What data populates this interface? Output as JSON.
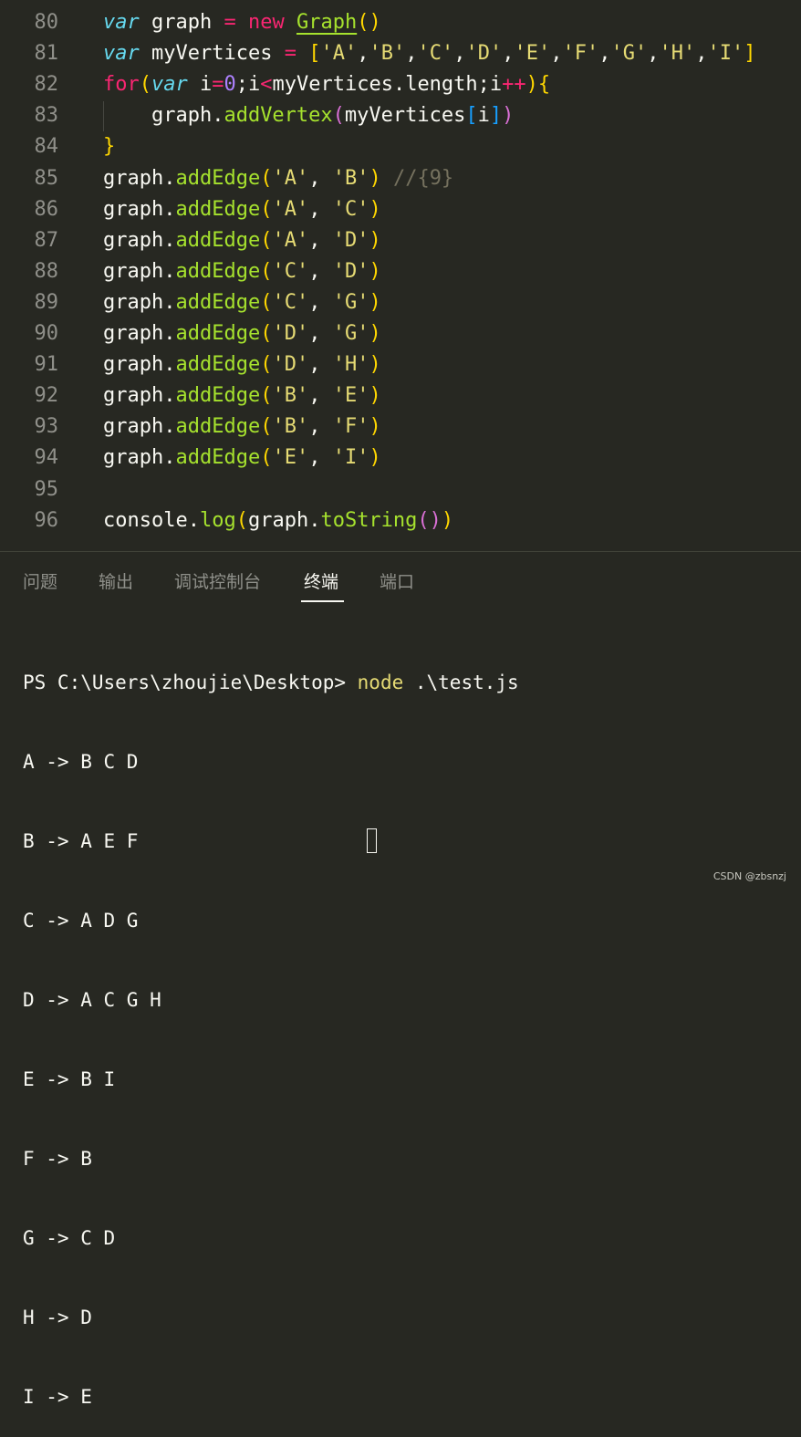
{
  "editor": {
    "lines": [
      {
        "n": "80",
        "tokens": [
          [
            "kw",
            "var"
          ],
          [
            "white",
            " graph "
          ],
          [
            "pink",
            "="
          ],
          [
            "white",
            " "
          ],
          [
            "pink",
            "new"
          ],
          [
            "white",
            " "
          ],
          [
            "cls",
            "Graph"
          ],
          [
            "b1",
            "()"
          ]
        ]
      },
      {
        "n": "81",
        "tokens": [
          [
            "kw",
            "var"
          ],
          [
            "white",
            " myVertices "
          ],
          [
            "pink",
            "="
          ],
          [
            "white",
            " "
          ],
          [
            "b1",
            "["
          ],
          [
            "str",
            "'A'"
          ],
          [
            "white",
            ","
          ],
          [
            "str",
            "'B'"
          ],
          [
            "white",
            ","
          ],
          [
            "str",
            "'C'"
          ],
          [
            "white",
            ","
          ],
          [
            "str",
            "'D'"
          ],
          [
            "white",
            ","
          ],
          [
            "str",
            "'E'"
          ],
          [
            "white",
            ","
          ],
          [
            "str",
            "'F'"
          ],
          [
            "white",
            ","
          ],
          [
            "str",
            "'G'"
          ],
          [
            "white",
            ","
          ],
          [
            "str",
            "'H'"
          ],
          [
            "white",
            ","
          ],
          [
            "str",
            "'I'"
          ],
          [
            "b1",
            "]"
          ]
        ]
      },
      {
        "n": "82",
        "tokens": [
          [
            "pink",
            "for"
          ],
          [
            "b1",
            "("
          ],
          [
            "kw",
            "var"
          ],
          [
            "white",
            " i"
          ],
          [
            "pink",
            "="
          ],
          [
            "num",
            "0"
          ],
          [
            "white",
            ";i"
          ],
          [
            "pink",
            "<"
          ],
          [
            "white",
            "myVertices.length;i"
          ],
          [
            "pink",
            "++"
          ],
          [
            "b1",
            ")"
          ],
          [
            "b1",
            "{"
          ]
        ]
      },
      {
        "n": "83",
        "tokens": [
          [
            "white",
            "    graph."
          ],
          [
            "fn",
            "addVertex"
          ],
          [
            "b2",
            "("
          ],
          [
            "white",
            "myVertices"
          ],
          [
            "b3",
            "["
          ],
          [
            "white",
            "i"
          ],
          [
            "b3",
            "]"
          ],
          [
            "b2",
            ")"
          ]
        ]
      },
      {
        "n": "84",
        "tokens": [
          [
            "b1",
            "}"
          ]
        ]
      },
      {
        "n": "85",
        "tokens": [
          [
            "white",
            "graph."
          ],
          [
            "fn",
            "addEdge"
          ],
          [
            "b1",
            "("
          ],
          [
            "str",
            "'A'"
          ],
          [
            "white",
            ", "
          ],
          [
            "str",
            "'B'"
          ],
          [
            "b1",
            ")"
          ],
          [
            "white",
            " "
          ],
          [
            "cmt",
            "//{9}"
          ]
        ]
      },
      {
        "n": "86",
        "tokens": [
          [
            "white",
            "graph."
          ],
          [
            "fn",
            "addEdge"
          ],
          [
            "b1",
            "("
          ],
          [
            "str",
            "'A'"
          ],
          [
            "white",
            ", "
          ],
          [
            "str",
            "'C'"
          ],
          [
            "b1",
            ")"
          ]
        ]
      },
      {
        "n": "87",
        "tokens": [
          [
            "white",
            "graph."
          ],
          [
            "fn",
            "addEdge"
          ],
          [
            "b1",
            "("
          ],
          [
            "str",
            "'A'"
          ],
          [
            "white",
            ", "
          ],
          [
            "str",
            "'D'"
          ],
          [
            "b1",
            ")"
          ]
        ]
      },
      {
        "n": "88",
        "tokens": [
          [
            "white",
            "graph."
          ],
          [
            "fn",
            "addEdge"
          ],
          [
            "b1",
            "("
          ],
          [
            "str",
            "'C'"
          ],
          [
            "white",
            ", "
          ],
          [
            "str",
            "'D'"
          ],
          [
            "b1",
            ")"
          ]
        ]
      },
      {
        "n": "89",
        "tokens": [
          [
            "white",
            "graph."
          ],
          [
            "fn",
            "addEdge"
          ],
          [
            "b1",
            "("
          ],
          [
            "str",
            "'C'"
          ],
          [
            "white",
            ", "
          ],
          [
            "str",
            "'G'"
          ],
          [
            "b1",
            ")"
          ]
        ]
      },
      {
        "n": "90",
        "tokens": [
          [
            "white",
            "graph."
          ],
          [
            "fn",
            "addEdge"
          ],
          [
            "b1",
            "("
          ],
          [
            "str",
            "'D'"
          ],
          [
            "white",
            ", "
          ],
          [
            "str",
            "'G'"
          ],
          [
            "b1",
            ")"
          ]
        ]
      },
      {
        "n": "91",
        "tokens": [
          [
            "white",
            "graph."
          ],
          [
            "fn",
            "addEdge"
          ],
          [
            "b1",
            "("
          ],
          [
            "str",
            "'D'"
          ],
          [
            "white",
            ", "
          ],
          [
            "str",
            "'H'"
          ],
          [
            "b1",
            ")"
          ]
        ]
      },
      {
        "n": "92",
        "tokens": [
          [
            "white",
            "graph."
          ],
          [
            "fn",
            "addEdge"
          ],
          [
            "b1",
            "("
          ],
          [
            "str",
            "'B'"
          ],
          [
            "white",
            ", "
          ],
          [
            "str",
            "'E'"
          ],
          [
            "b1",
            ")"
          ]
        ]
      },
      {
        "n": "93",
        "tokens": [
          [
            "white",
            "graph."
          ],
          [
            "fn",
            "addEdge"
          ],
          [
            "b1",
            "("
          ],
          [
            "str",
            "'B'"
          ],
          [
            "white",
            ", "
          ],
          [
            "str",
            "'F'"
          ],
          [
            "b1",
            ")"
          ]
        ]
      },
      {
        "n": "94",
        "tokens": [
          [
            "white",
            "graph."
          ],
          [
            "fn",
            "addEdge"
          ],
          [
            "b1",
            "("
          ],
          [
            "str",
            "'E'"
          ],
          [
            "white",
            ", "
          ],
          [
            "str",
            "'I'"
          ],
          [
            "b1",
            ")"
          ]
        ]
      },
      {
        "n": "95",
        "tokens": []
      },
      {
        "n": "96",
        "tokens": [
          [
            "white",
            "console."
          ],
          [
            "fn",
            "log"
          ],
          [
            "b1",
            "("
          ],
          [
            "white",
            "graph."
          ],
          [
            "fn",
            "toString"
          ],
          [
            "b2",
            "()"
          ],
          [
            "b1",
            ")"
          ]
        ]
      }
    ]
  },
  "panel": {
    "tabs": [
      {
        "label": "问题",
        "active": false
      },
      {
        "label": "输出",
        "active": false
      },
      {
        "label": "调试控制台",
        "active": false
      },
      {
        "label": "终端",
        "active": true
      },
      {
        "label": "端口",
        "active": false
      }
    ]
  },
  "terminal": {
    "prompt": "PS C:\\Users\\zhoujie\\Desktop> ",
    "command": "node",
    "args": " .\\test.js",
    "output": [
      "A -> B C D",
      "B -> A E F",
      "C -> A D G",
      "D -> A C G H",
      "E -> B I",
      "F -> B",
      "G -> C D",
      "H -> D",
      "I -> E"
    ]
  },
  "watermark": "CSDN @zbsnzj",
  "colors": {
    "background": "#272822",
    "keyword": "#66d9ef",
    "operator": "#f92672",
    "function": "#a6e22e",
    "string": "#e6db74",
    "number": "#ae81ff",
    "comment": "#75715e"
  }
}
